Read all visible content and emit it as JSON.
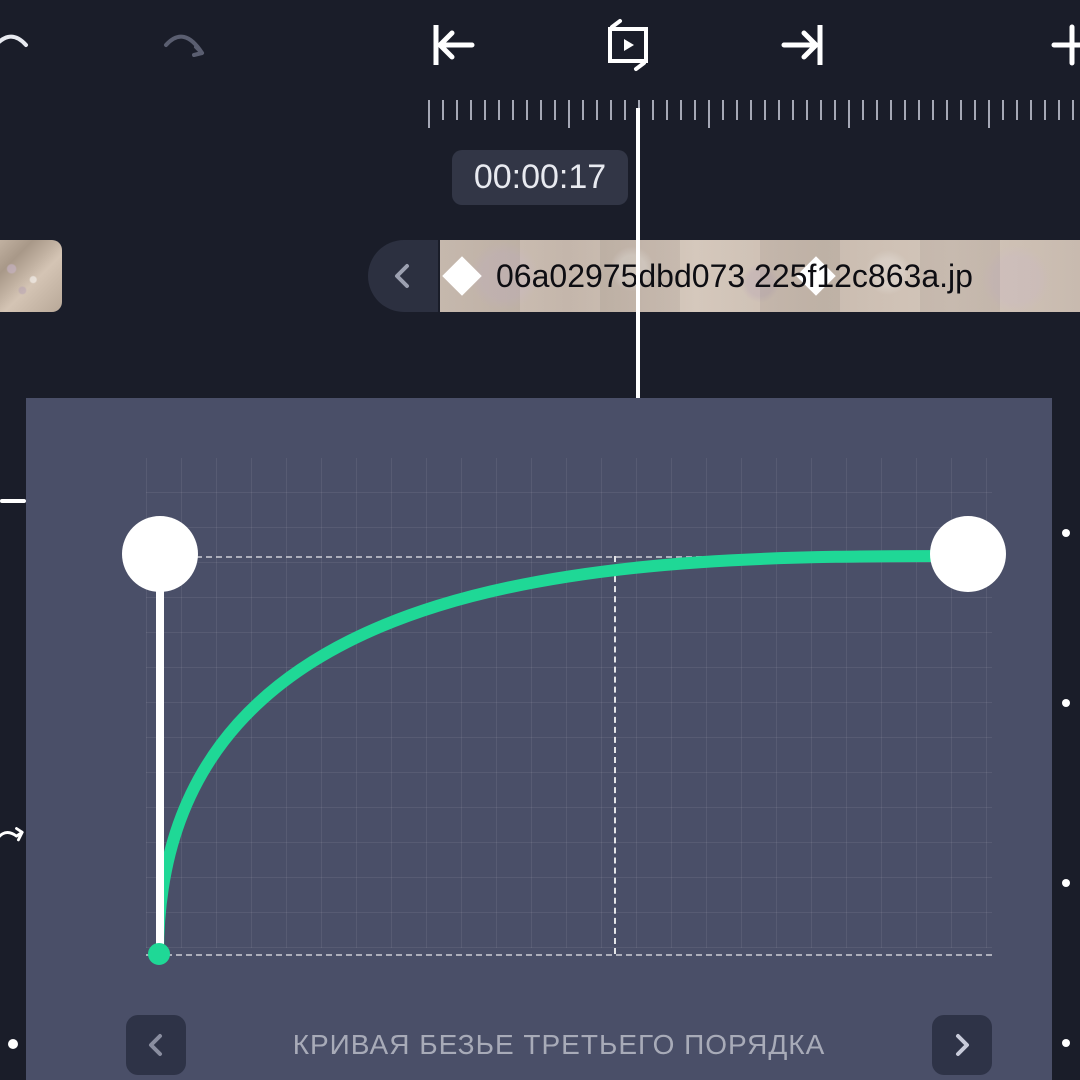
{
  "toolbar": {
    "undo": "undo",
    "redo": "redo",
    "goto_start": "go-to-start",
    "play_loop": "play-loop",
    "goto_end": "go-to-end",
    "add": "add"
  },
  "timeline": {
    "timecode": "00:00:17",
    "clip_filename": "06a02975dbd073  225f12c863a.jp"
  },
  "curve": {
    "label": "КРИВАЯ БЕЗЬЕ ТРЕТЬЕГО ПОРЯДКА",
    "handle1": {
      "x": 0.0,
      "y": 0.0
    },
    "handle1_control": {
      "x": 0.0,
      "y": 1.0
    },
    "handle2": {
      "x": 1.0,
      "y": 1.0
    },
    "color": "#1fd896"
  },
  "chart_data": {
    "type": "line",
    "title": "КРИВАЯ БЕЗЬЕ ТРЕТЬЕГО ПОРЯДКА",
    "xlabel": "",
    "ylabel": "",
    "xlim": [
      0,
      1
    ],
    "ylim": [
      0,
      1
    ],
    "bezier": {
      "p0": [
        0.0,
        0.0
      ],
      "p1": [
        0.0,
        1.0
      ],
      "p2": [
        0.6,
        1.0
      ],
      "p3": [
        1.0,
        1.0
      ]
    },
    "playhead_x": 0.57
  }
}
